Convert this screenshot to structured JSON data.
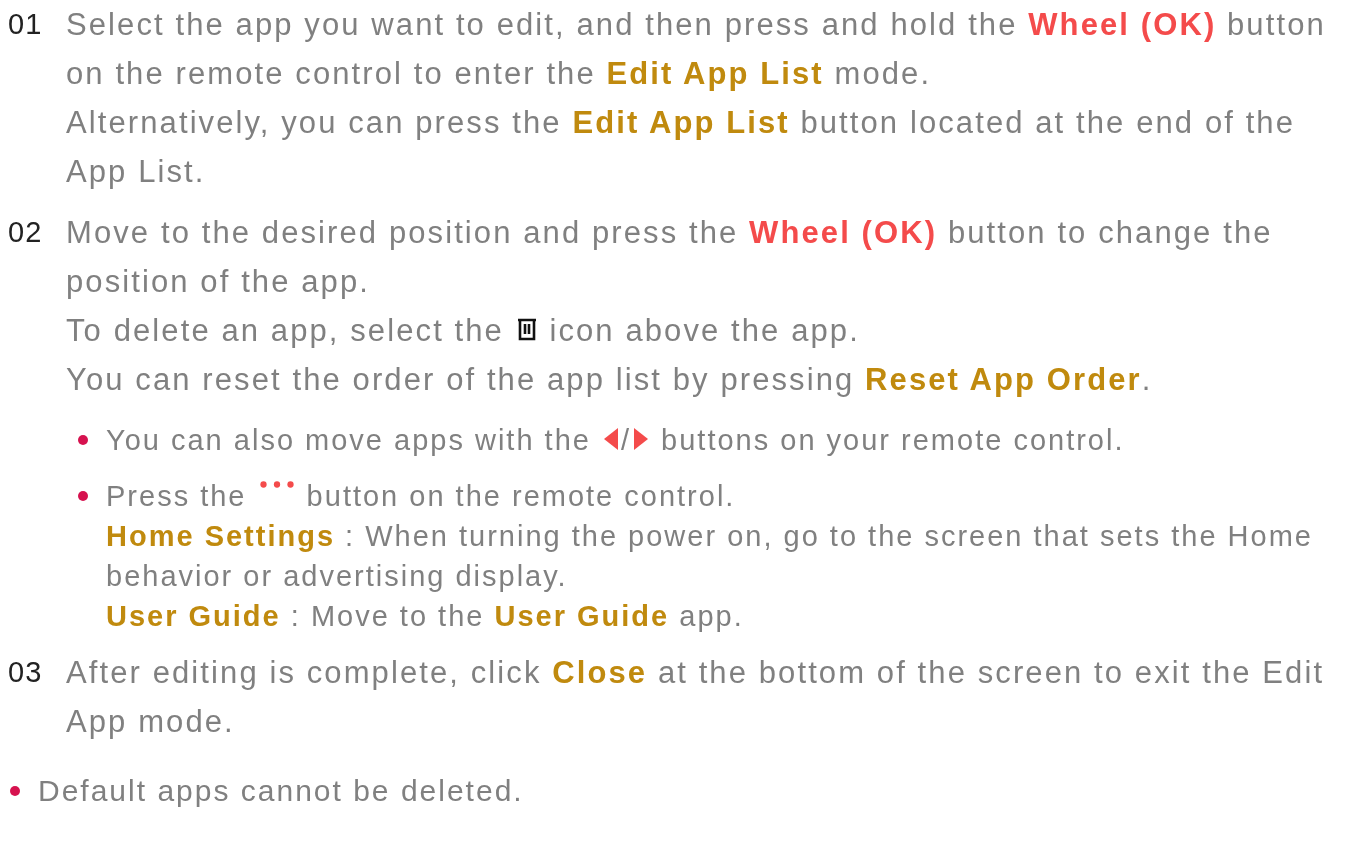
{
  "steps": [
    {
      "number": "01",
      "paragraphs": [
        [
          {
            "kind": "text",
            "text": "Select the app you want to edit, and then press and hold the "
          },
          {
            "kind": "red",
            "text": "Wheel (OK)"
          },
          {
            "kind": "text",
            "text": " button on the remote control to enter the "
          },
          {
            "kind": "gold",
            "text": "Edit App List"
          },
          {
            "kind": "text",
            "text": " mode."
          }
        ],
        [
          {
            "kind": "text",
            "text": "Alternatively, you can press the "
          },
          {
            "kind": "gold",
            "text": "Edit App List"
          },
          {
            "kind": "text",
            "text": " button located at the end of the App List."
          }
        ]
      ]
    },
    {
      "number": "02",
      "paragraphs": [
        [
          {
            "kind": "text",
            "text": "Move to the desired position and press the "
          },
          {
            "kind": "red",
            "text": "Wheel (OK)"
          },
          {
            "kind": "text",
            "text": " button to change the position of the app."
          }
        ],
        [
          {
            "kind": "text",
            "text": "To delete an app, select the "
          },
          {
            "kind": "trash"
          },
          {
            "kind": "text",
            "text": " icon above the app."
          }
        ],
        [
          {
            "kind": "text",
            "text": "You can reset the order of the app list by pressing "
          },
          {
            "kind": "gold",
            "text": "Reset App Order"
          },
          {
            "kind": "text",
            "text": "."
          }
        ]
      ],
      "notes": [
        {
          "paragraphs": [
            [
              {
                "kind": "text",
                "text": "You can also move apps with the "
              },
              {
                "kind": "left"
              },
              {
                "kind": "text",
                "text": "/"
              },
              {
                "kind": "right"
              },
              {
                "kind": "text",
                "text": " buttons on your remote control."
              }
            ]
          ]
        },
        {
          "paragraphs": [
            [
              {
                "kind": "text",
                "text": "Press the "
              },
              {
                "kind": "dots"
              },
              {
                "kind": "text",
                "text": " button on the remote control."
              }
            ],
            [
              {
                "kind": "gold",
                "text": "Home Settings"
              },
              {
                "kind": "text",
                "text": " : When turning the power on, go to the screen that sets the Home behavior or advertising display."
              }
            ],
            [
              {
                "kind": "gold",
                "text": "User Guide"
              },
              {
                "kind": "text",
                "text": " : Move to the "
              },
              {
                "kind": "gold",
                "text": "User Guide"
              },
              {
                "kind": "text",
                "text": " app."
              }
            ]
          ]
        }
      ]
    },
    {
      "number": "03",
      "paragraphs": [
        [
          {
            "kind": "text",
            "text": "After editing is complete, click "
          },
          {
            "kind": "gold",
            "text": "Close"
          },
          {
            "kind": "text",
            "text": " at the bottom of the screen to exit the Edit App mode."
          }
        ]
      ]
    }
  ],
  "notes": [
    {
      "paragraphs": [
        [
          {
            "kind": "text",
            "text": "Default apps cannot be deleted."
          }
        ]
      ]
    }
  ]
}
